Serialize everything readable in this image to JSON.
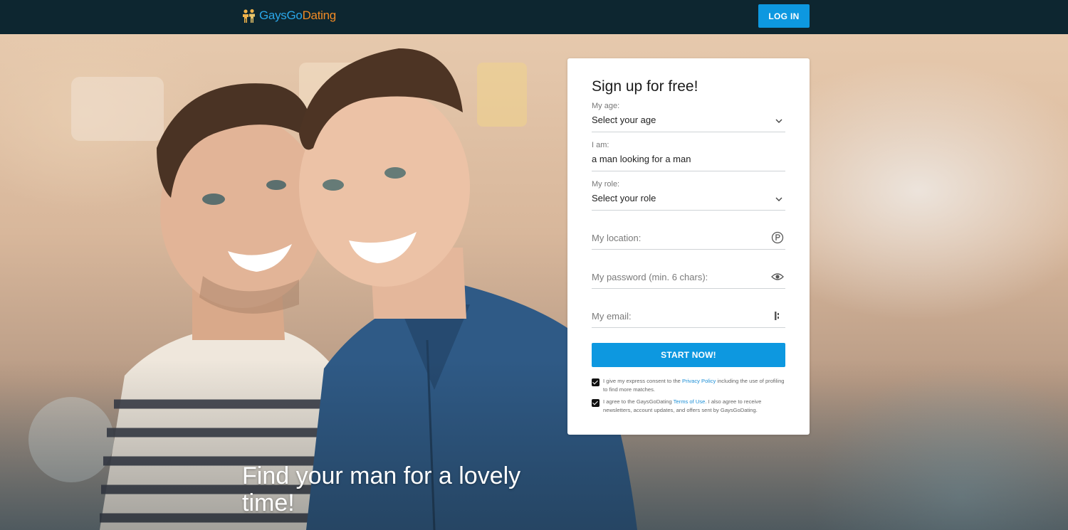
{
  "header": {
    "logo_part1": "Gays",
    "logo_part2": "Go",
    "logo_part3": "Dating",
    "login_label": "LOG IN"
  },
  "hero": {
    "headline": "Find your man for a lovely time!"
  },
  "signup": {
    "title": "Sign up for free!",
    "age": {
      "label": "My age:",
      "value": "Select your age"
    },
    "iam": {
      "label": "I am:",
      "value": "a man looking for a man"
    },
    "role": {
      "label": "My role:",
      "value": "Select your role"
    },
    "location": {
      "placeholder": "My location:"
    },
    "password": {
      "placeholder": "My password (min. 6 chars):"
    },
    "email": {
      "placeholder": "My email:"
    },
    "start_label": "START NOW!",
    "consent1": {
      "before": "I give my express consent to the ",
      "link": "Privacy Policy",
      "after": " including the use of profiling to find more matches."
    },
    "consent2": {
      "before": "I agree to the GaysGoDating ",
      "link": "Terms of Use",
      "after": ". I also agree to receive newsletters, account updates, and offers sent by GaysGoDating."
    }
  },
  "colors": {
    "topbar": "#0d2630",
    "accent": "#0d98e0",
    "logo_blue": "#2aa6e8",
    "logo_orange": "#f08a25"
  },
  "icons": [
    "logo-people-icon",
    "chevron-down-icon",
    "location-icon",
    "eye-icon",
    "email-icon",
    "checkbox-checked-icon"
  ]
}
